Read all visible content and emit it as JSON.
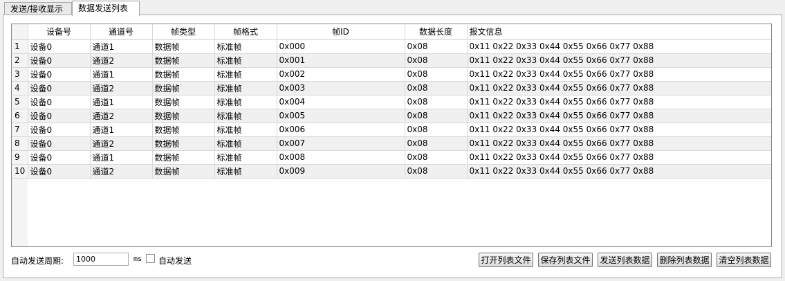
{
  "tabs": [
    "发送/接收显示",
    "数据发送列表"
  ],
  "table": {
    "headers": [
      "设备号",
      "通道号",
      "帧类型",
      "帧格式",
      "帧ID",
      "数据长度",
      "报文信息"
    ],
    "rows": [
      {
        "num": "1",
        "device": "设备0",
        "channel": "通道1",
        "type": "数据帧",
        "format": "标准帧",
        "id": "0x000",
        "len": "0x08",
        "data": "0x11 0x22 0x33 0x44 0x55 0x66 0x77 0x88"
      },
      {
        "num": "2",
        "device": "设备0",
        "channel": "通道2",
        "type": "数据帧",
        "format": "标准帧",
        "id": "0x001",
        "len": "0x08",
        "data": "0x11 0x22 0x33 0x44 0x55 0x66 0x77 0x88"
      },
      {
        "num": "3",
        "device": "设备0",
        "channel": "通道1",
        "type": "数据帧",
        "format": "标准帧",
        "id": "0x002",
        "len": "0x08",
        "data": "0x11 0x22 0x33 0x44 0x55 0x66 0x77 0x88"
      },
      {
        "num": "4",
        "device": "设备0",
        "channel": "通道2",
        "type": "数据帧",
        "format": "标准帧",
        "id": "0x003",
        "len": "0x08",
        "data": "0x11 0x22 0x33 0x44 0x55 0x66 0x77 0x88"
      },
      {
        "num": "5",
        "device": "设备0",
        "channel": "通道1",
        "type": "数据帧",
        "format": "标准帧",
        "id": "0x004",
        "len": "0x08",
        "data": "0x11 0x22 0x33 0x44 0x55 0x66 0x77 0x88"
      },
      {
        "num": "6",
        "device": "设备0",
        "channel": "通道2",
        "type": "数据帧",
        "format": "标准帧",
        "id": "0x005",
        "len": "0x08",
        "data": "0x11 0x22 0x33 0x44 0x55 0x66 0x77 0x88"
      },
      {
        "num": "7",
        "device": "设备0",
        "channel": "通道1",
        "type": "数据帧",
        "format": "标准帧",
        "id": "0x006",
        "len": "0x08",
        "data": "0x11 0x22 0x33 0x44 0x55 0x66 0x77 0x88"
      },
      {
        "num": "8",
        "device": "设备0",
        "channel": "通道2",
        "type": "数据帧",
        "format": "标准帧",
        "id": "0x007",
        "len": "0x08",
        "data": "0x11 0x22 0x33 0x44 0x55 0x66 0x77 0x88"
      },
      {
        "num": "9",
        "device": "设备0",
        "channel": "通道1",
        "type": "数据帧",
        "format": "标准帧",
        "id": "0x008",
        "len": "0x08",
        "data": "0x11 0x22 0x33 0x44 0x55 0x66 0x77 0x88"
      },
      {
        "num": "10",
        "device": "设备0",
        "channel": "通道2",
        "type": "数据帧",
        "format": "标准帧",
        "id": "0x009",
        "len": "0x08",
        "data": "0x11 0x22 0x33 0x44 0x55 0x66 0x77 0x88"
      }
    ]
  },
  "controls": {
    "period_label": "自动发送周期:",
    "period_value": "1000",
    "ms_label": "ms",
    "auto_send_label": "自动发送",
    "auto_send_checked": false,
    "buttons": [
      "打开列表文件",
      "保存列表文件",
      "发送列表数据",
      "删除列表数据",
      "清空列表数据"
    ]
  }
}
